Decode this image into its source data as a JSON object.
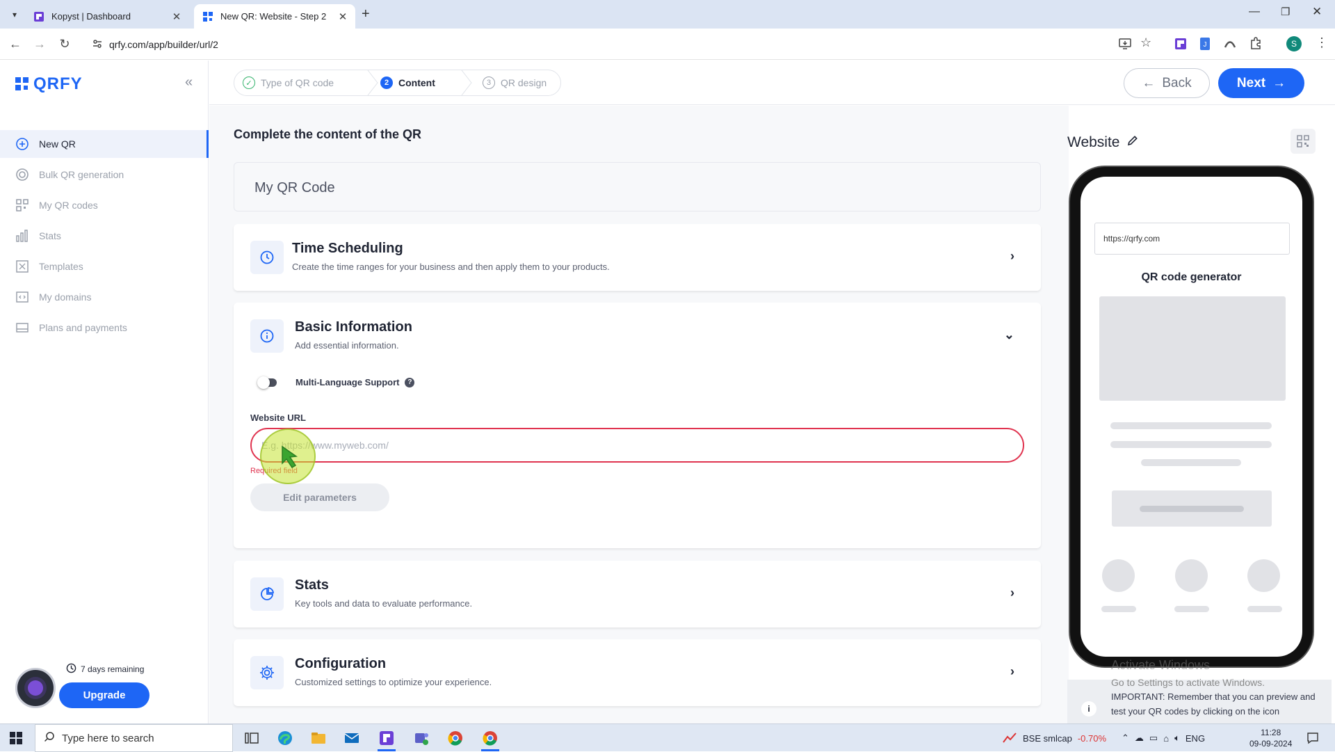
{
  "browser": {
    "tabs": [
      {
        "title": "Kopyst | Dashboard"
      },
      {
        "title": "New QR: Website - Step 2"
      }
    ],
    "url": "qrfy.com/app/builder/url/2",
    "profile_initial": "S"
  },
  "sidebar": {
    "logo": "QRFY",
    "items": [
      {
        "label": "New QR",
        "icon": "plus-circle-icon",
        "active": true
      },
      {
        "label": "Bulk QR generation",
        "icon": "target-icon"
      },
      {
        "label": "My QR codes",
        "icon": "qr-grid-icon"
      },
      {
        "label": "Stats",
        "icon": "bar-chart-icon"
      },
      {
        "label": "Templates",
        "icon": "template-icon"
      },
      {
        "label": "My domains",
        "icon": "domain-icon"
      },
      {
        "label": "Plans and payments",
        "icon": "card-icon"
      }
    ],
    "trial": {
      "days_remaining": "7 days remaining",
      "upgrade_label": "Upgrade"
    }
  },
  "stepper": {
    "steps": [
      {
        "label": "Type of QR code",
        "state": "done"
      },
      {
        "number": "2",
        "label": "Content",
        "state": "current"
      },
      {
        "number": "3",
        "label": "QR design",
        "state": "todo"
      }
    ],
    "back_label": "Back",
    "next_label": "Next"
  },
  "content": {
    "title": "Complete the content of the QR",
    "qr_name": "My QR Code",
    "sections": {
      "time_scheduling": {
        "title": "Time Scheduling",
        "subtitle": "Create the time ranges for your business and then apply them to your products."
      },
      "basic_info": {
        "title": "Basic Information",
        "subtitle": "Add essential information."
      },
      "stats": {
        "title": "Stats",
        "subtitle": "Key tools and data to evaluate performance."
      },
      "configuration": {
        "title": "Configuration",
        "subtitle": "Customized settings to optimize your experience."
      }
    },
    "multi_language_label": "Multi-Language Support",
    "website_url": {
      "label": "Website URL",
      "placeholder": "E.g. https://www.myweb.com/",
      "value": "",
      "error": "Required field"
    },
    "edit_parameters_label": "Edit parameters"
  },
  "preview": {
    "title": "Website",
    "url": "https://qrfy.com",
    "heading": "QR code generator",
    "watermark_line1": "Activate Windows",
    "watermark_line2": "Go to Settings to activate Windows.",
    "info_text": "IMPORTANT: Remember that you can preview and test your QR codes by clicking on the icon"
  },
  "taskbar": {
    "search_placeholder": "Type here to search",
    "stock_name": "BSE smlcap",
    "stock_change": "-0.70%",
    "language": "ENG",
    "time": "11:28",
    "date": "09-09-2024"
  },
  "colors": {
    "accent": "#1e66f5",
    "error": "#e0334f",
    "success": "#33b36b"
  }
}
